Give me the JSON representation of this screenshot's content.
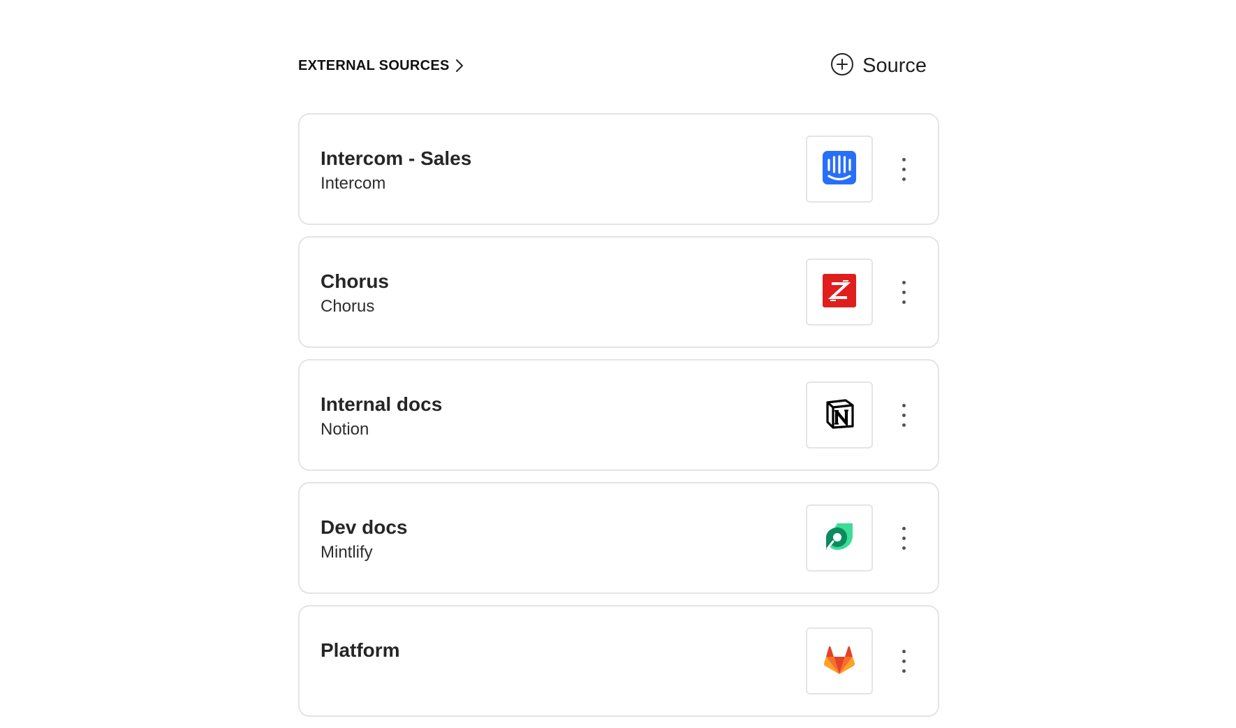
{
  "header": {
    "title": "EXTERNAL SOURCES",
    "add_button_label": "Source"
  },
  "sources": [
    {
      "title": "Intercom - Sales",
      "type": "Intercom",
      "icon": "intercom-logo-icon",
      "color": "#286EFA"
    },
    {
      "title": "Chorus",
      "type": "Chorus",
      "icon": "chorus-logo-icon",
      "color": "#E01E1E"
    },
    {
      "title": "Internal docs",
      "type": "Notion",
      "icon": "notion-logo-icon",
      "color": "#000000"
    },
    {
      "title": "Dev docs",
      "type": "Mintlify",
      "icon": "mintlify-logo-icon",
      "color": "#1EA672"
    },
    {
      "title": "Platform",
      "type": "",
      "icon": "gitlab-logo-icon",
      "color": "#E24329"
    }
  ]
}
